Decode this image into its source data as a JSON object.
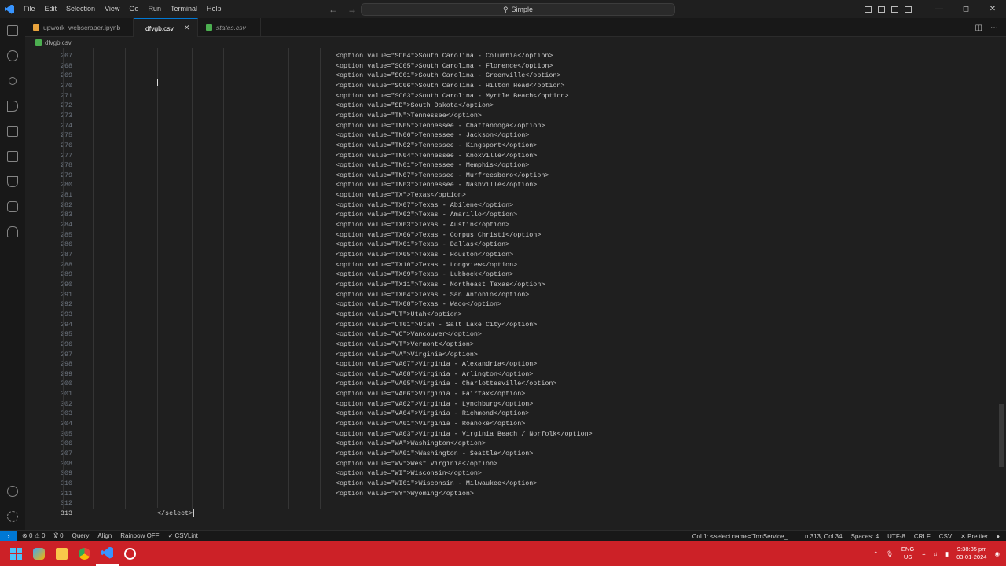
{
  "menu": [
    "File",
    "Edit",
    "Selection",
    "View",
    "Go",
    "Run",
    "Terminal",
    "Help"
  ],
  "command_center": {
    "label": "Simple"
  },
  "tabs": [
    {
      "label": "upwork_webscraper.ipynb",
      "icon_color": "#e8a33d",
      "active": false
    },
    {
      "label": "dfvgb.csv",
      "icon_color": "#4caf50",
      "active": true
    },
    {
      "label": "states.csv",
      "icon_color": "#4caf50",
      "active": false
    }
  ],
  "breadcrumb": {
    "file": "dfvgb.csv"
  },
  "editor": {
    "first_line": 267,
    "lines": [
      "<option value=\"SC04\">South Carolina - Columbia</option>",
      "<option value=\"SC05\">South Carolina - Florence</option>",
      "<option value=\"SC01\">South Carolina - Greenville</option>",
      "<option value=\"SC06\">South Carolina - Hilton Head</option>",
      "<option value=\"SC03\">South Carolina - Myrtle Beach</option>",
      "<option value=\"SD\">South Dakota</option>",
      "<option value=\"TN\">Tennessee</option>",
      "<option value=\"TN05\">Tennessee - Chattanooga</option>",
      "<option value=\"TN06\">Tennessee - Jackson</option>",
      "<option value=\"TN02\">Tennessee - Kingsport</option>",
      "<option value=\"TN04\">Tennessee - Knoxville</option>",
      "<option value=\"TN01\">Tennessee - Memphis</option>",
      "<option value=\"TN07\">Tennessee - Murfreesboro</option>",
      "<option value=\"TN03\">Tennessee - Nashville</option>",
      "<option value=\"TX\">Texas</option>",
      "<option value=\"TX07\">Texas - Abilene</option>",
      "<option value=\"TX02\">Texas - Amarillo</option>",
      "<option value=\"TX03\">Texas - Austin</option>",
      "<option value=\"TX06\">Texas - Corpus Christi</option>",
      "<option value=\"TX01\">Texas - Dallas</option>",
      "<option value=\"TX05\">Texas - Houston</option>",
      "<option value=\"TX10\">Texas - Longview</option>",
      "<option value=\"TX09\">Texas - Lubbock</option>",
      "<option value=\"TX11\">Texas - Northeast Texas</option>",
      "<option value=\"TX04\">Texas - San Antonio</option>",
      "<option value=\"TX08\">Texas - Waco</option>",
      "<option value=\"UT\">Utah</option>",
      "<option value=\"UT01\">Utah - Salt Lake City</option>",
      "<option value=\"VC\">Vancouver</option>",
      "<option value=\"VT\">Vermont</option>",
      "<option value=\"VA\">Virginia</option>",
      "<option value=\"VA07\">Virginia - Alexandria</option>",
      "<option value=\"VA08\">Virginia - Arlington</option>",
      "<option value=\"VA05\">Virginia - Charlottesville</option>",
      "<option value=\"VA06\">Virginia - Fairfax</option>",
      "<option value=\"VA02\">Virginia - Lynchburg</option>",
      "<option value=\"VA04\">Virginia - Richmond</option>",
      "<option value=\"VA01\">Virginia - Roanoke</option>",
      "<option value=\"VA03\">Virginia - Virginia Beach / Norfolk</option>",
      "<option value=\"WA\">Washington</option>",
      "<option value=\"WA01\">Washington - Seattle</option>",
      "<option value=\"WV\">West Virginia</option>",
      "<option value=\"WI\">Wisconsin</option>",
      "<option value=\"WI01\">Wisconsin - Milwaukee</option>",
      "<option value=\"WY\">Wyoming</option>",
      ""
    ],
    "last_line_number": 313,
    "last_line_text": "</select>",
    "current_line": 313
  },
  "status": {
    "errors": "0",
    "warnings": "0",
    "ports": "0",
    "query": "Query",
    "align": "Align",
    "rainbow": "Rainbow OFF",
    "csvlint": "CSVLint",
    "col_info": "Col 1: <select name=\"frmService_...",
    "position": "Ln 313, Col 34",
    "spaces": "Spaces: 4",
    "encoding": "UTF-8",
    "eol": "CRLF",
    "language": "CSV",
    "formatter": "Prettier"
  },
  "taskbar": {
    "lang_top": "ENG",
    "lang_bottom": "US",
    "time": "9:38:35 pm",
    "date": "03-01-2024"
  },
  "colors": {
    "accent": "#0078d4",
    "taskbar": "#cc2127"
  }
}
